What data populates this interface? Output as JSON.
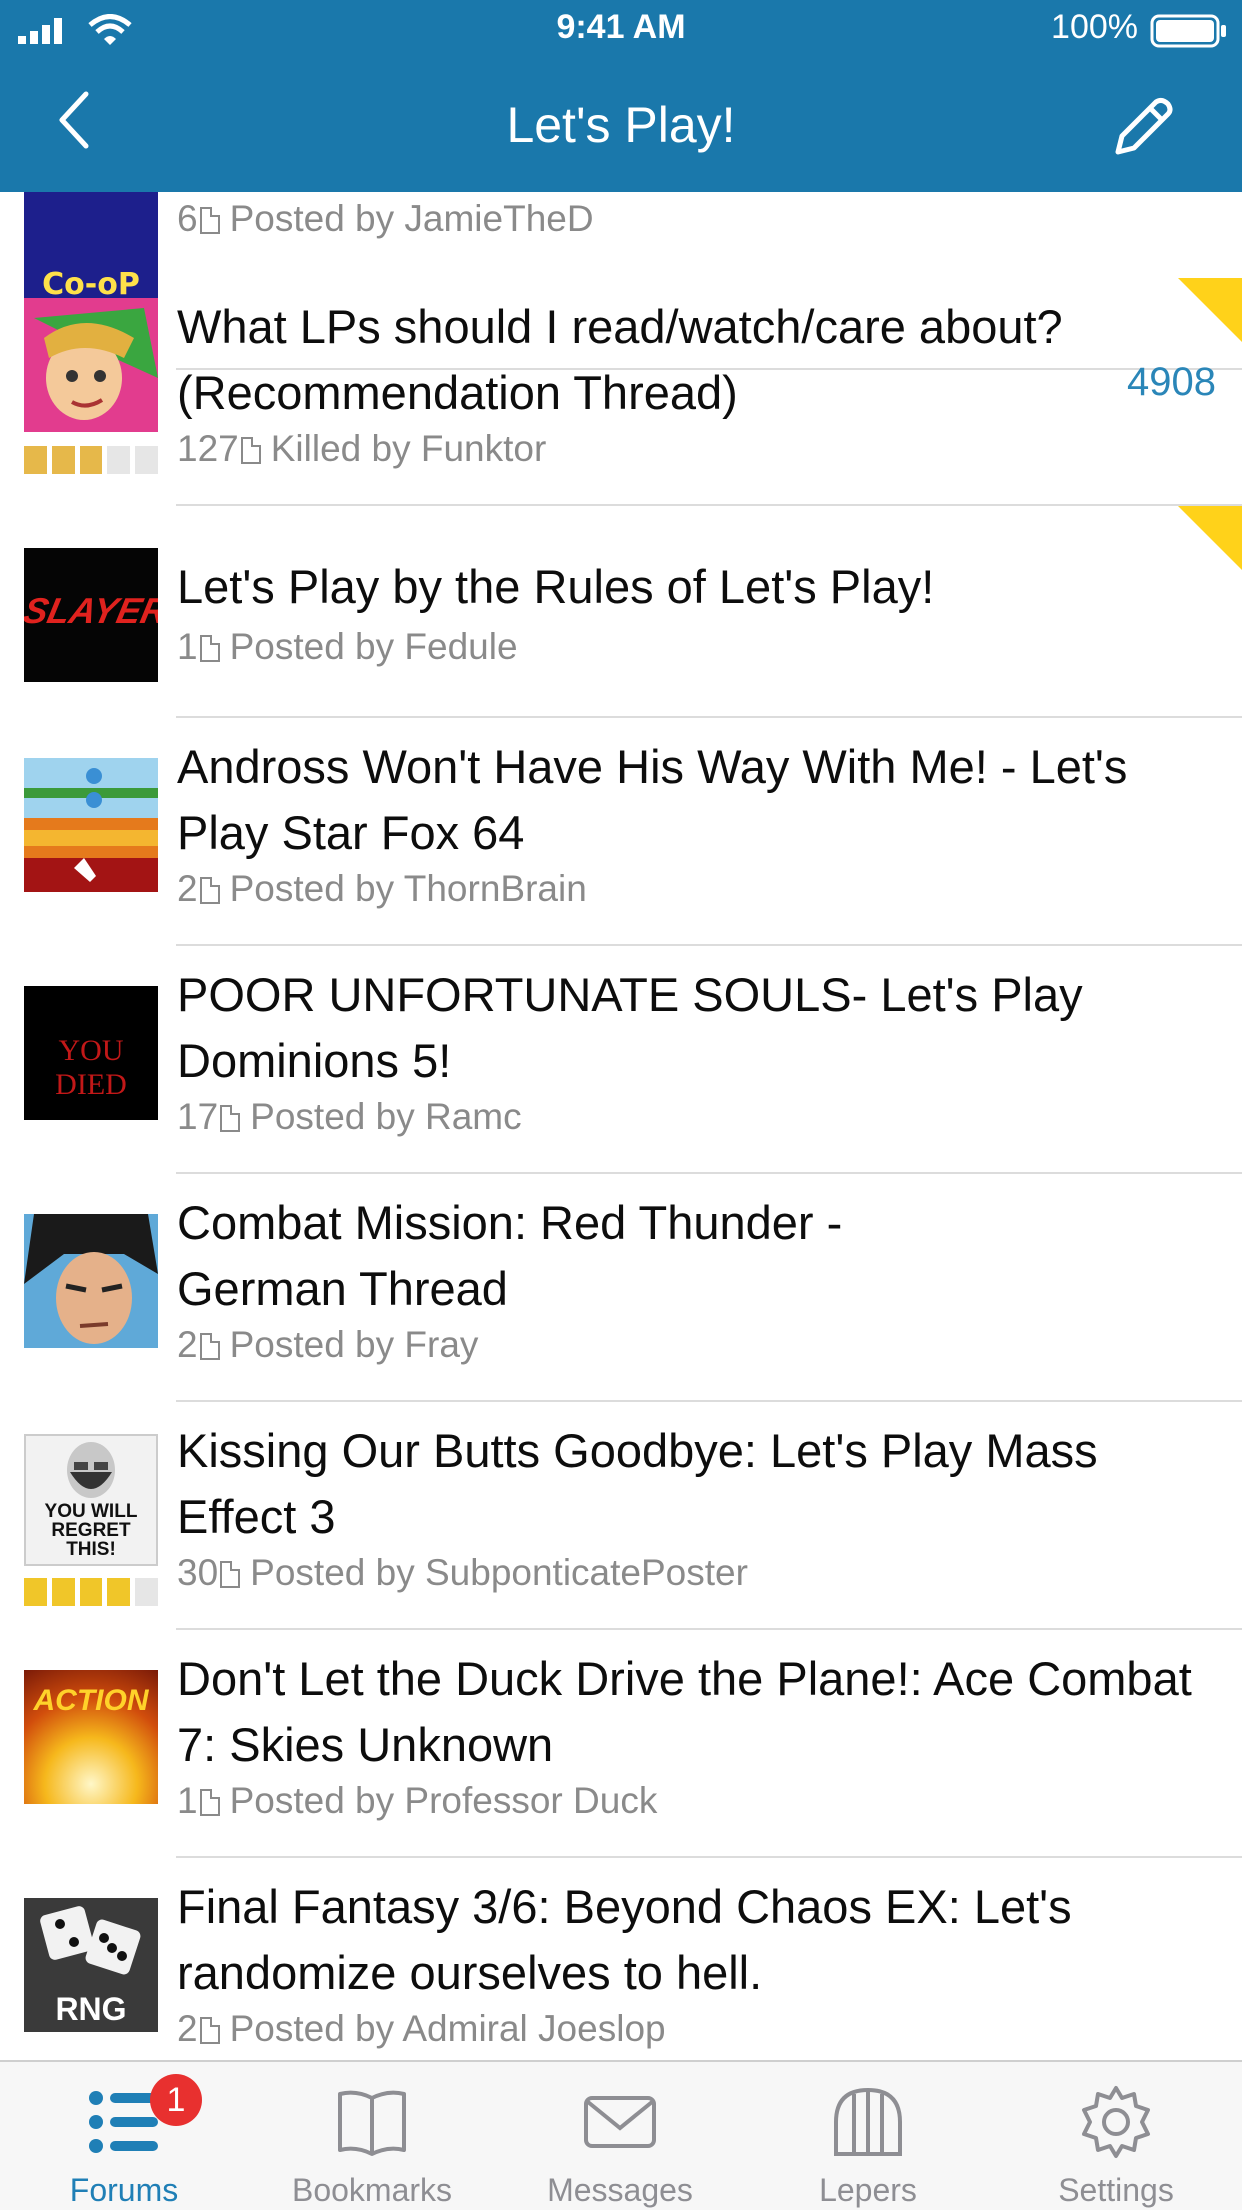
{
  "status_bar": {
    "time": "9:41 AM",
    "battery": "100%"
  },
  "nav": {
    "title": "Let's Play!",
    "back_icon": "chevron-left-icon",
    "compose_icon": "pencil-icon"
  },
  "threads": [
    {
      "avatar_text": "Co-oP",
      "title": "",
      "pages": "6",
      "meta": "Posted by JamieTheD"
    },
    {
      "avatar_text": "",
      "title": "What LPs should I read/watch/care about? (Recommendation Thread)",
      "pages": "127",
      "meta": "Killed by Funktor",
      "unread": "4908",
      "rating": 3
    },
    {
      "avatar_text": "SLAYER",
      "title": "Let's Play by the Rules of Let's Play!",
      "pages": "1",
      "meta": "Posted by Fedule"
    },
    {
      "avatar_text": "",
      "title": "Andross Won't Have His Way With Me! - Let's Play Star Fox 64",
      "pages": "2",
      "meta": "Posted by ThornBrain"
    },
    {
      "avatar_text": "YOU DIED",
      "title": "POOR UNFORTUNATE SOULS- Let's Play Dominions 5!",
      "pages": "17",
      "meta": "Posted by Ramc"
    },
    {
      "avatar_text": "",
      "title": "Combat Mission: Red Thunder - German Thread",
      "pages": "2",
      "meta": "Posted by Fray"
    },
    {
      "avatar_text": "YOU WILL REGRET THIS!",
      "title": "Kissing Our Butts Goodbye: Let's Play Mass Effect 3",
      "pages": "30",
      "meta": "Posted by SubponticatePoster",
      "rating": 4
    },
    {
      "avatar_text": "ACTION",
      "title": "Don't Let the Duck Drive the Plane!: Ace Combat 7: Skies Unknown",
      "pages": "1",
      "meta": "Posted by Professor Duck"
    },
    {
      "avatar_text": "RNG",
      "title": "Final Fantasy 3/6: Beyond Chaos EX: Let's randomize ourselves to hell.",
      "pages": "2",
      "meta": "Posted by Admiral Joeslop"
    }
  ],
  "tabs": [
    {
      "label": "Forums",
      "icon": "list-icon",
      "badge": "1",
      "active": true
    },
    {
      "label": "Bookmarks",
      "icon": "book-icon"
    },
    {
      "label": "Messages",
      "icon": "envelope-icon"
    },
    {
      "label": "Lepers",
      "icon": "cage-icon"
    },
    {
      "label": "Settings",
      "icon": "gear-icon"
    }
  ],
  "colors": {
    "accent": "#1a78ab",
    "tab_active": "#1f7fb6",
    "badge": "#e8302f",
    "sticky": "#ffd21a"
  }
}
